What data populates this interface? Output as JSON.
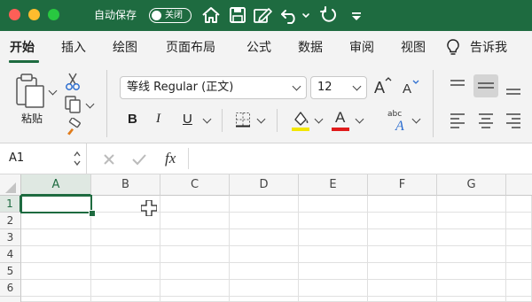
{
  "titlebar": {
    "autosave_label": "自动保存",
    "toggle_label": "关闭"
  },
  "tabs": [
    {
      "label": "开始",
      "active": true
    },
    {
      "label": "插入"
    },
    {
      "label": "绘图"
    },
    {
      "label": "页面布局"
    },
    {
      "label": "公式"
    },
    {
      "label": "数据"
    },
    {
      "label": "审阅"
    },
    {
      "label": "视图"
    },
    {
      "label": "告诉我"
    }
  ],
  "ribbon": {
    "paste_label": "粘贴",
    "font_name": "等线 Regular (正文)",
    "font_size": "12",
    "bold": "B",
    "italic": "I",
    "underline": "U",
    "font_color_glyph": "A",
    "abc_label": "abc"
  },
  "formula_bar": {
    "name_box": "A1",
    "fx": "fx"
  },
  "sheet": {
    "columns": [
      "A",
      "B",
      "C",
      "D",
      "E",
      "F",
      "G"
    ],
    "rows": [
      "1",
      "2",
      "3",
      "4",
      "5",
      "6"
    ],
    "active_cell": "A1"
  },
  "colors": {
    "title_bg": "#1e6b40",
    "fill_accent": "#f2e600",
    "font_accent": "#e01b1b",
    "selection": "#1e6b40"
  }
}
